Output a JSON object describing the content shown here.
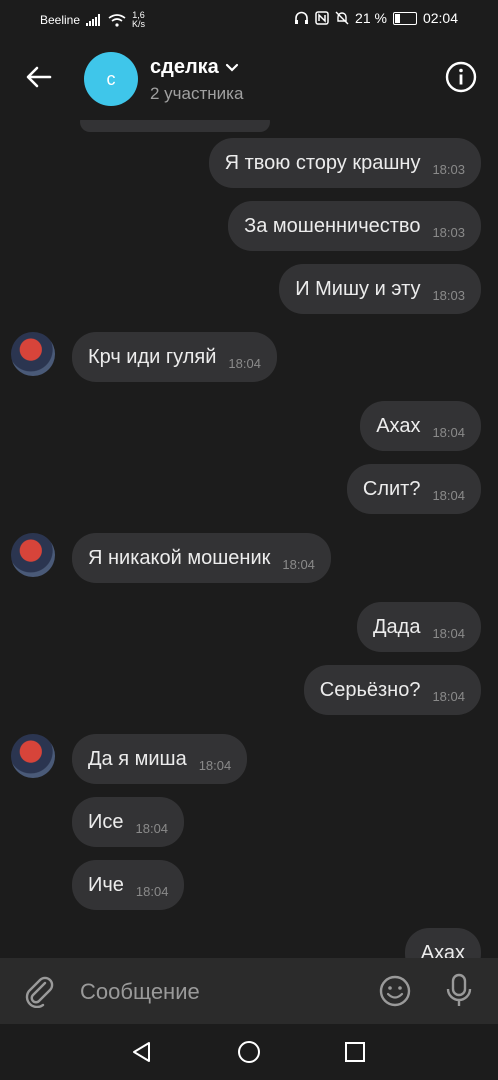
{
  "status": {
    "carrier": "Beeline",
    "speed": "1,6",
    "speed_unit": "K/s",
    "battery": "21 %",
    "battery_level": 0.21,
    "time": "02:04"
  },
  "header": {
    "avatar_letter": "с",
    "title": "сделка",
    "subtitle": "2 участника"
  },
  "messages": [
    {
      "text": "Я твою стору крашну",
      "time": "18:03",
      "direction": "out"
    },
    {
      "text": "За мошенничество",
      "time": "18:03",
      "direction": "out"
    },
    {
      "text": "И Мишу и эту",
      "time": "18:03",
      "direction": "out"
    },
    {
      "text": "Крч иди гуляй",
      "time": "18:04",
      "direction": "in"
    },
    {
      "text": "Ахах",
      "time": "18:04",
      "direction": "out"
    },
    {
      "text": "Слит?",
      "time": "18:04",
      "direction": "out"
    },
    {
      "text": "Я никакой мошеник",
      "time": "18:04",
      "direction": "in"
    },
    {
      "text": "Дада",
      "time": "18:04",
      "direction": "out"
    },
    {
      "text": "Серьёзно?",
      "time": "18:04",
      "direction": "out"
    },
    {
      "text": "Да я миша",
      "time": "18:04",
      "direction": "in"
    },
    {
      "text": "Исе",
      "time": "18:04",
      "direction": "in"
    },
    {
      "text": "Иче",
      "time": "18:04",
      "direction": "in"
    },
    {
      "text": "Ахах",
      "time": "",
      "direction": "out"
    }
  ],
  "composer": {
    "placeholder": "Сообщение"
  },
  "icons": {
    "back": "arrow-left-icon",
    "info": "info-icon",
    "attach": "paperclip-icon",
    "emoji": "smiley-icon",
    "mic": "microphone-icon"
  },
  "colors": {
    "background": "#1c1c1c",
    "bubble": "#333335",
    "group_avatar": "#3fc6ea"
  }
}
